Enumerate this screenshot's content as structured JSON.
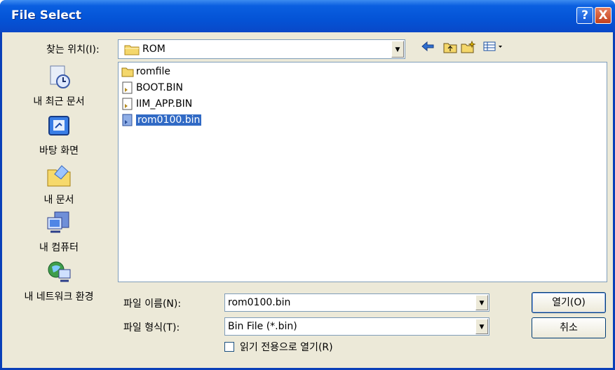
{
  "window": {
    "title": "File Select"
  },
  "title_buttons": {
    "help": "?",
    "close": "X"
  },
  "lookin": {
    "label": "찾는 위치(I):",
    "value": "ROM"
  },
  "toolbar": {
    "back_icon": "back-arrow-icon",
    "up_icon": "up-folder-icon",
    "new_folder_icon": "new-folder-icon",
    "view_icon": "view-menu-icon"
  },
  "places": [
    {
      "label": "내 최근 문서",
      "icon": "recent-documents-icon"
    },
    {
      "label": "바탕 화면",
      "icon": "desktop-icon"
    },
    {
      "label": "내 문서",
      "icon": "my-documents-icon"
    },
    {
      "label": "내 컴퓨터",
      "icon": "my-computer-icon"
    },
    {
      "label": "내 네트워크 환경",
      "icon": "network-icon"
    }
  ],
  "files": [
    {
      "name": "romfile",
      "type": "folder"
    },
    {
      "name": "BOOT.BIN",
      "type": "file"
    },
    {
      "name": "IIM_APP.BIN",
      "type": "file"
    },
    {
      "name": "rom0100.bin",
      "type": "file",
      "selected": true
    }
  ],
  "filename": {
    "label": "파일 이름(N):",
    "value": "rom0100.bin"
  },
  "filetype": {
    "label": "파일 형식(T):",
    "value": "Bin File (*.bin)"
  },
  "buttons": {
    "open": "열기(O)",
    "cancel": "취소"
  },
  "readonly": {
    "label": "읽기 전용으로 열기(R)",
    "checked": false
  },
  "colors": {
    "title_bar": "#0453d6",
    "selection": "#316ac5",
    "dialog_bg": "#ece9d8"
  }
}
